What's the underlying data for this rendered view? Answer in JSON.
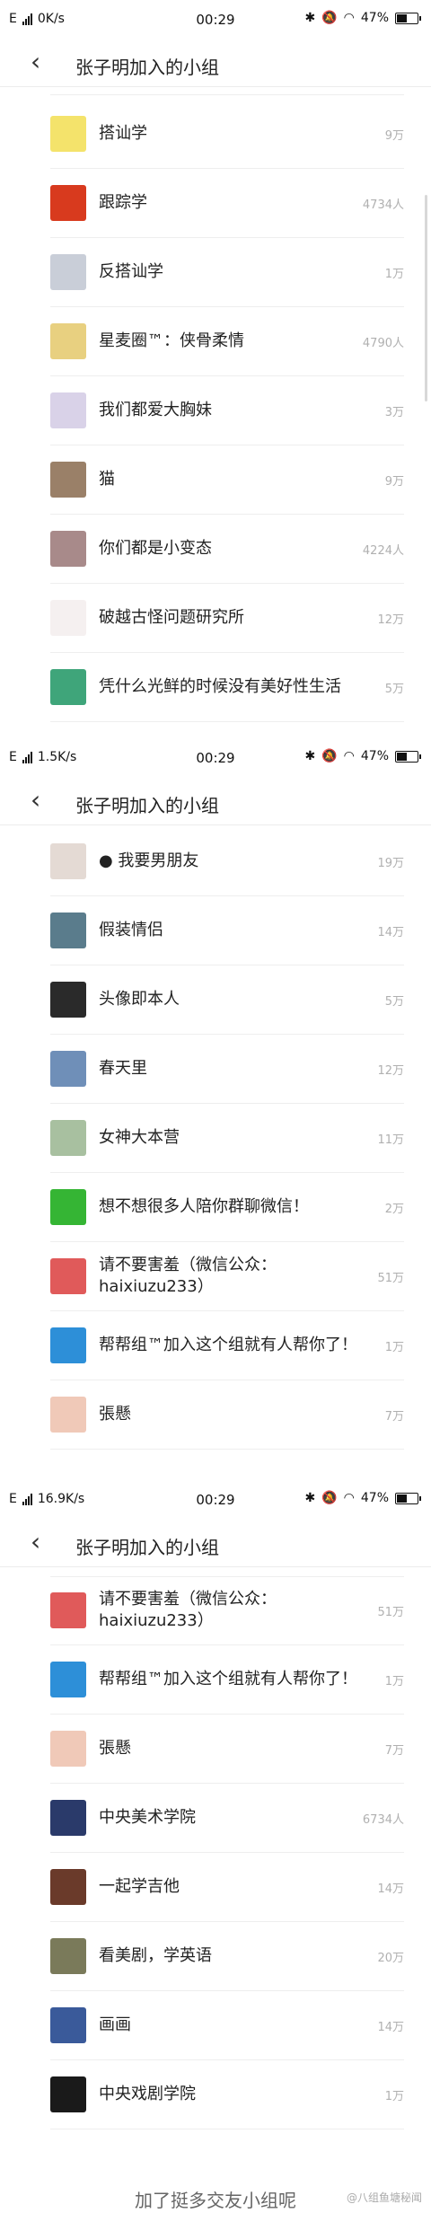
{
  "title": "张子明加入的小组",
  "shots": [
    {
      "status": {
        "carrier": "E",
        "speed": "0K/s",
        "time": "00:29",
        "battery": "47%"
      },
      "items": [
        {
          "name": "搭讪学",
          "count": "9万",
          "icon": "book-avatar",
          "color": "#f4e36b"
        },
        {
          "name": "跟踪学",
          "count": "4734人",
          "icon": "red-avatar",
          "color": "#d83a1e"
        },
        {
          "name": "反搭讪学",
          "count": "1万",
          "icon": "photo-avatar",
          "color": "#c9ced8"
        },
        {
          "name": "星麦圈™：侠骨柔情",
          "count": "4790人",
          "icon": "badge-avatar",
          "color": "#e8d080"
        },
        {
          "name": "我们都爱大胸妹",
          "count": "3万",
          "icon": "anime-avatar",
          "color": "#d9d2e8"
        },
        {
          "name": "猫",
          "count": "9万",
          "icon": "cat-avatar",
          "color": "#9a8068"
        },
        {
          "name": "你们都是小变态",
          "count": "4224人",
          "icon": "girl-avatar",
          "color": "#a88a8a"
        },
        {
          "name": "破越古怪问题研究所",
          "count": "12万",
          "icon": "flask-avatar",
          "color": "#f5f0f0"
        },
        {
          "name": "凭什么光鲜的时候没有美好性生活",
          "count": "5万",
          "icon": "drawing-avatar",
          "color": "#3fa57a"
        }
      ]
    },
    {
      "status": {
        "carrier": "E",
        "speed": "1.5K/s",
        "time": "00:29",
        "battery": "47%"
      },
      "items": [
        {
          "name": "● 我要男朋友",
          "count": "19万",
          "icon": "pattern-avatar",
          "color": "#e4dad4"
        },
        {
          "name": "假装情侣",
          "count": "14万",
          "icon": "sea-avatar",
          "color": "#5a7c8c"
        },
        {
          "name": "头像即本人",
          "count": "5万",
          "icon": "dark-avatar",
          "color": "#2a2a2a"
        },
        {
          "name": "春天里",
          "count": "12万",
          "icon": "city-avatar",
          "color": "#6f8fb8"
        },
        {
          "name": "女神大本营",
          "count": "11万",
          "icon": "sunset-avatar",
          "color": "#a8c0a0"
        },
        {
          "name": "想不想很多人陪你群聊微信！",
          "count": "2万",
          "icon": "wechat-avatar",
          "color": "#35b534"
        },
        {
          "name": "请不要害羞（微信公众：haixiuzu233）",
          "count": "51万",
          "icon": "nohaixiu-avatar",
          "color": "#e05a5a"
        },
        {
          "name": "帮帮组™加入这个组就有人帮你了！",
          "count": "1万",
          "icon": "doraemon-avatar",
          "color": "#2d8fd8"
        },
        {
          "name": "張懸",
          "count": "7万",
          "icon": "pink-avatar",
          "color": "#f0c9b8"
        }
      ]
    },
    {
      "status": {
        "carrier": "E",
        "speed": "16.9K/s",
        "time": "00:29",
        "battery": "47%"
      },
      "items": [
        {
          "name": "请不要害羞（微信公众：haixiuzu233）",
          "count": "51万",
          "icon": "nohaixiu-avatar",
          "color": "#e05a5a"
        },
        {
          "name": "帮帮组™加入这个组就有人帮你了！",
          "count": "1万",
          "icon": "doraemon-avatar",
          "color": "#2d8fd8"
        },
        {
          "name": "張懸",
          "count": "7万",
          "icon": "pink-avatar",
          "color": "#f0c9b8"
        },
        {
          "name": "中央美术学院",
          "count": "6734人",
          "icon": "cafa-avatar",
          "color": "#2a3a6a"
        },
        {
          "name": "一起学吉他",
          "count": "14万",
          "icon": "guitar-avatar",
          "color": "#6a3a2a"
        },
        {
          "name": "看美剧，学英语",
          "count": "20万",
          "icon": "soldier-avatar",
          "color": "#7a7a5a"
        },
        {
          "name": "画画",
          "count": "14万",
          "icon": "paint-avatar",
          "color": "#3a5a9a"
        },
        {
          "name": "中央戏剧学院",
          "count": "1万",
          "icon": "drama-avatar",
          "color": "#1a1a1a"
        }
      ],
      "footer": "加了挺多交友小组呢",
      "watermark": "@八组鱼塘秘闻"
    }
  ]
}
